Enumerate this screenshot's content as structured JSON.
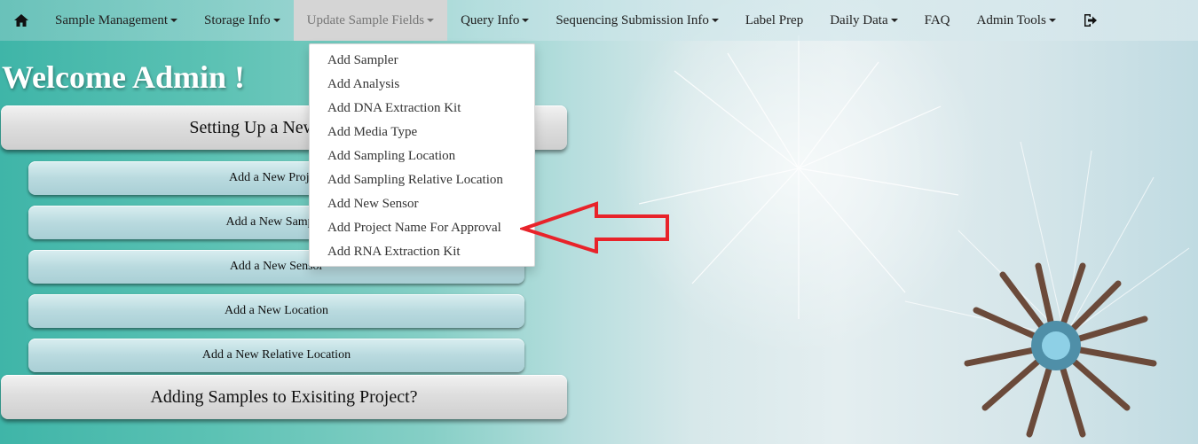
{
  "navbar": {
    "home_icon": "home-icon",
    "items": [
      {
        "label": "Sample Management",
        "caret": true
      },
      {
        "label": "Storage Info",
        "caret": true
      },
      {
        "label": "Update Sample Fields",
        "caret": true
      },
      {
        "label": "Query Info",
        "caret": true
      },
      {
        "label": "Sequencing Submission Info",
        "caret": true
      },
      {
        "label": "Label Prep",
        "caret": false
      },
      {
        "label": "Daily Data",
        "caret": true
      },
      {
        "label": "FAQ",
        "caret": false
      },
      {
        "label": "Admin Tools",
        "caret": true
      }
    ],
    "logout_icon": "logout-icon"
  },
  "dropdown": {
    "items": [
      "Add Sampler",
      "Add Analysis",
      "Add DNA Extraction Kit",
      "Add Media Type",
      "Add Sampling Location",
      "Add Sampling Relative Location",
      "Add New Sensor",
      "Add Project Name For Approval",
      "Add RNA Extraction Kit"
    ]
  },
  "main": {
    "welcome": "Welcome Admin !",
    "setup_button": "Setting Up a New Project?",
    "sub_buttons": [
      "Add a New Project",
      "Add a New Sampler",
      "Add a New Sensor",
      "Add a New Location",
      "Add a New Relative Location"
    ],
    "existing_button": "Adding Samples to Exisiting Project?"
  },
  "colors": {
    "arrow": "#e8232a",
    "active_nav": "#d5d5d5"
  }
}
